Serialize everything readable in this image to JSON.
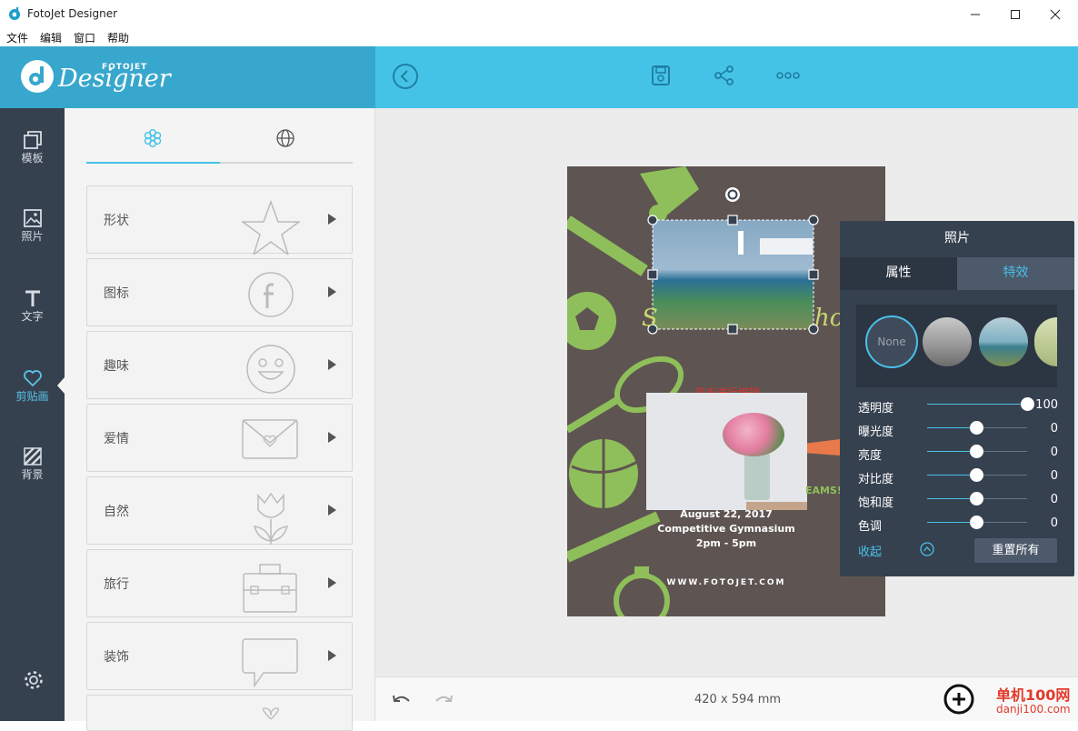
{
  "window": {
    "title": "FotoJet Designer"
  },
  "menu": [
    "文件",
    "编辑",
    "窗口",
    "帮助"
  ],
  "logo": {
    "brand": "Designer",
    "small": "FOTOJET"
  },
  "nav": [
    {
      "label": "模板",
      "icon": "template-icon"
    },
    {
      "label": "照片",
      "icon": "photo-icon"
    },
    {
      "label": "文字",
      "icon": "text-icon"
    },
    {
      "label": "剪贴画",
      "icon": "clipart-icon"
    },
    {
      "label": "背景",
      "icon": "background-icon"
    }
  ],
  "categories": [
    "形状",
    "图标",
    "趣味",
    "爱情",
    "自然",
    "旅行",
    "装饰"
  ],
  "poster": {
    "date": "August 22, 2017",
    "event": "Competitive Gymnasium",
    "time": "2pm - 5pm",
    "url": "WWW.FOTOJET.COM",
    "partial_text": "EAMS!",
    "edit_hint": "双击进行编辑"
  },
  "photo_panel": {
    "title": "照片",
    "tabs": [
      "属性",
      "特效"
    ],
    "filter_none": "None",
    "sliders": [
      {
        "label": "透明度",
        "value": 100
      },
      {
        "label": "曝光度",
        "value": 0
      },
      {
        "label": "亮度",
        "value": 0
      },
      {
        "label": "对比度",
        "value": 0
      },
      {
        "label": "饱和度",
        "value": 0
      },
      {
        "label": "色调",
        "value": 0
      }
    ],
    "collapse": "收起",
    "reset": "重置所有"
  },
  "status": {
    "size": "420 x 594 mm"
  },
  "watermark": {
    "text1": "单机100网",
    "text2": "danji100.com"
  },
  "colors": {
    "accent": "#45c3e6",
    "nav_bg": "#364150",
    "poster_bg": "#5e5552",
    "green": "#8fbf5a"
  }
}
